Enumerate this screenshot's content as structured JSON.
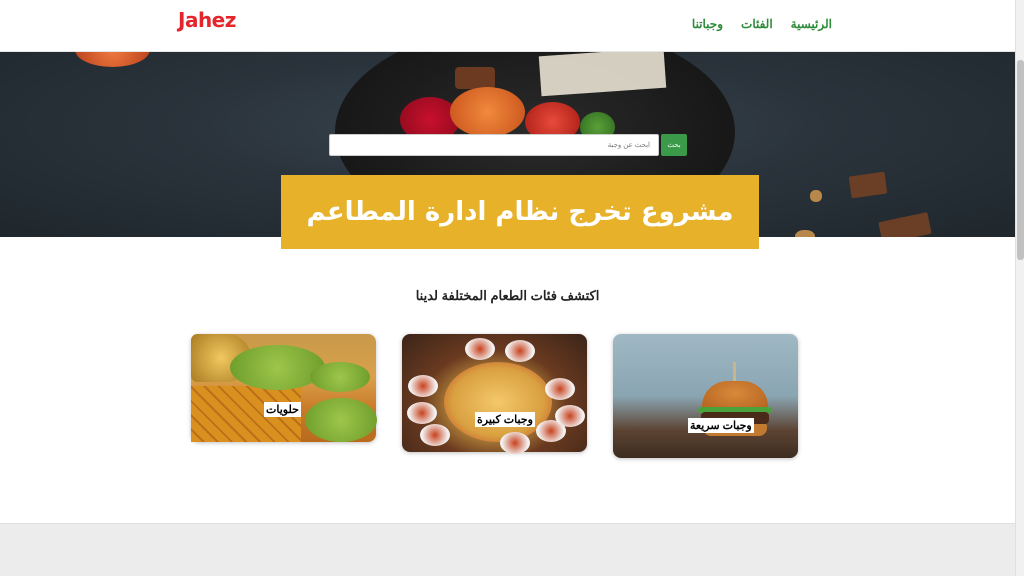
{
  "brand": {
    "logo": "Jahez",
    "accent": "#e4262c"
  },
  "nav": {
    "items": [
      {
        "label": "الرئيسية"
      },
      {
        "label": "الفئات"
      },
      {
        "label": "وجباتنا"
      }
    ],
    "link_color": "#2e8b3a"
  },
  "hero": {
    "search": {
      "placeholder": "ابحث عن وجبة",
      "button": "بحث"
    },
    "title": "مشروع تخرج نظام ادارة المطاعم",
    "banner_color": "#e7b12a"
  },
  "categories": {
    "heading": "اكتشف فئات الطعام المختلفة لدينا",
    "items": [
      {
        "label": "وجبات سريعة"
      },
      {
        "label": "وجبات كبيرة"
      },
      {
        "label": "حلويات"
      }
    ]
  }
}
